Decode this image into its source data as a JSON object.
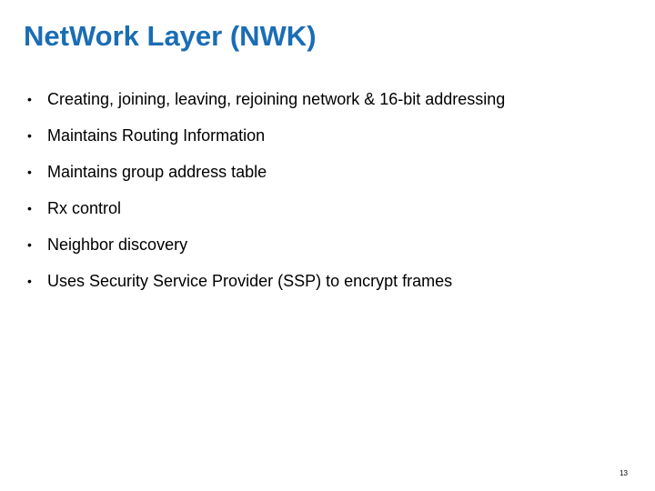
{
  "slide": {
    "title": "NetWork Layer (NWK)",
    "bullets": [
      "Creating, joining, leaving, rejoining network  & 16-bit addressing",
      "Maintains Routing Information",
      "Maintains group address table",
      "Rx control",
      "Neighbor discovery",
      "Uses Security Service Provider (SSP) to encrypt frames"
    ],
    "bullet_symbol": "•",
    "page_number": "13",
    "title_color": "#1a6db5"
  }
}
